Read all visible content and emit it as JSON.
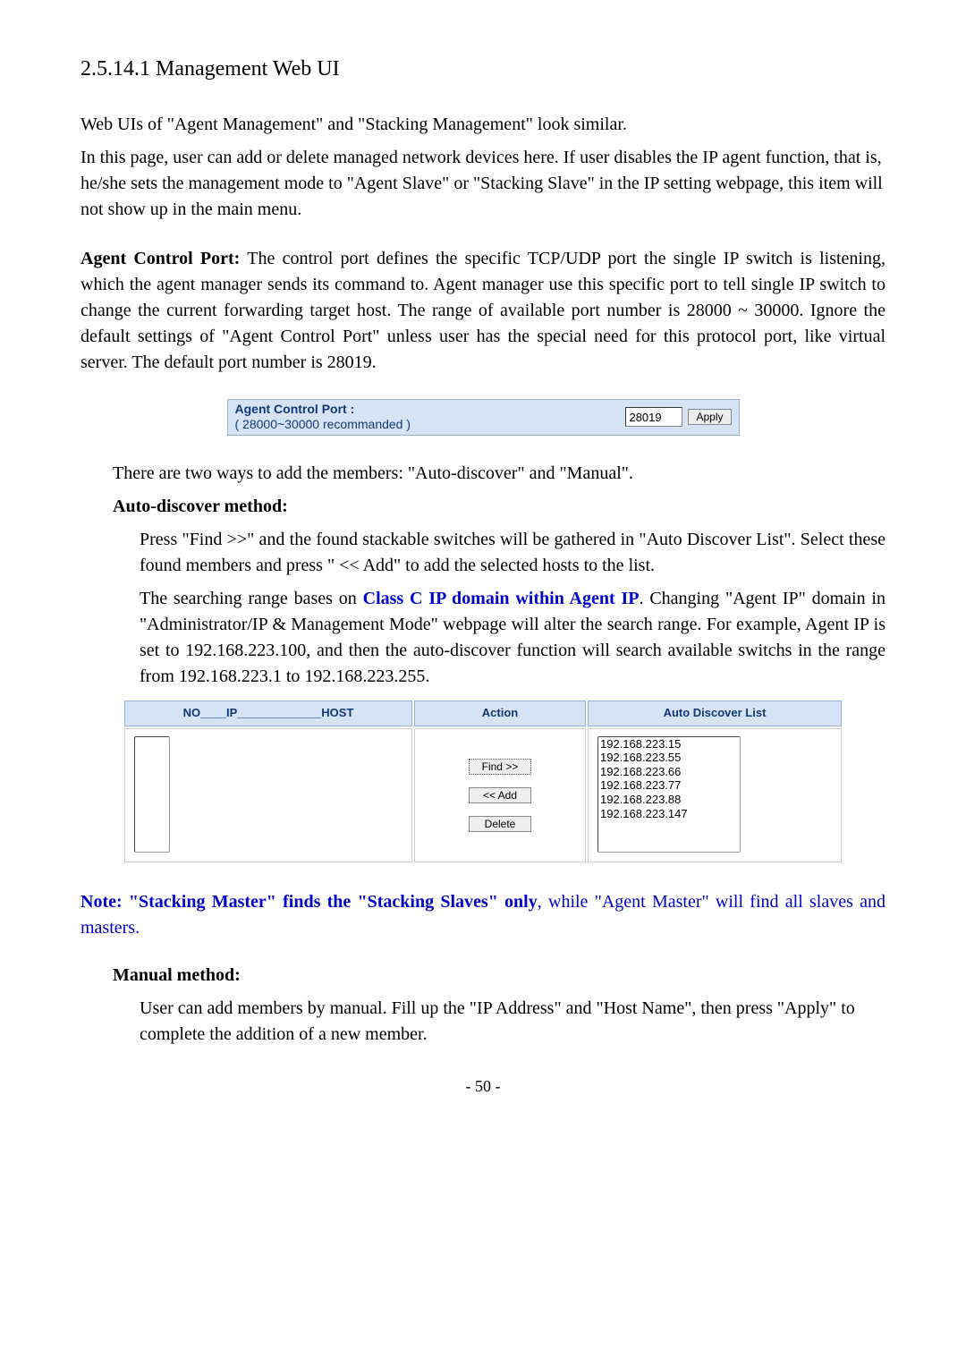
{
  "heading": "2.5.14.1 Management Web UI",
  "para1": "Web UIs of \"Agent Management\" and \"Stacking Management\" look similar.",
  "para2": "In this page, user can add or delete managed network devices here. If user disables the IP agent function, that is, he/she sets the management mode to \"Agent Slave\" or \"Stacking Slave\" in the IP setting webpage, this item will not show up in the main menu.",
  "para3_bold": "Agent Control Port:",
  "para3_body": " The control port defines the specific TCP/UDP port the single IP switch is listening, which the agent manager sends its command to. Agent manager use this specific port to tell single IP switch to change the current forwarding target host. The range of available port number is 28000 ~ 30000. Ignore the default settings of \"Agent Control Port\" unless user has the special need for this protocol port, like virtual server. The default port number is 28019.",
  "port_figure": {
    "label_line1": "Agent Control Port :",
    "label_line2": "( 28000~30000 recommanded )",
    "value": "28019",
    "apply": "Apply"
  },
  "para4": "There are two ways to add the members: \"Auto-discover\" and \"Manual\".",
  "auto_head": "Auto-discover method:",
  "auto_p1": "Press \"Find >>\" and the found stackable switches will be gathered in \"Auto Discover List\". Select these found members and press \" << Add\" to add the selected hosts to the list.",
  "auto_p2_a": "The searching range bases on ",
  "auto_p2_link": "Class C IP domain within Agent IP",
  "auto_p2_b": ". Changing \"Agent IP\" domain in \"Administrator/IP & Management Mode\" webpage will alter the search range. For example, Agent IP is set to 192.168.223.100, and then the auto-discover function will search available switchs in the range from 192.168.223.1 to 192.168.223.255.",
  "discover": {
    "h_noip": "NO____IP_____________HOST",
    "h_action": "Action",
    "h_auto": "Auto Discover List",
    "btn_find": "Find >>",
    "btn_add": "<< Add",
    "btn_delete": "Delete",
    "list": [
      "192.168.223.15",
      "192.168.223.55",
      "192.168.223.66",
      "192.168.223.77",
      "192.168.223.88",
      "192.168.223.147"
    ]
  },
  "note_bold": "Note: \"Stacking Master\" finds the \"Stacking Slaves\" only",
  "note_rest": ", while \"Agent Master\" will find all slaves and masters.",
  "manual_head": "Manual method:",
  "manual_p1": "User can add members by manual. Fill up the \"IP Address\" and \"Host Name\", then press \"Apply\" to complete the addition of a new member.",
  "pagenum": "- 50 -"
}
